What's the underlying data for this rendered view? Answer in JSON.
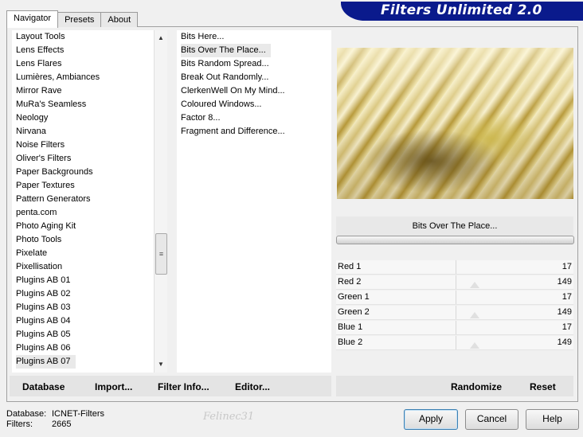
{
  "tabs": [
    {
      "label": "Navigator"
    },
    {
      "label": "Presets"
    },
    {
      "label": "About"
    }
  ],
  "header": {
    "title": "Filters Unlimited 2.0"
  },
  "categories": [
    "Layout Tools",
    "Lens Effects",
    "Lens Flares",
    "Lumières, Ambiances",
    "Mirror Rave",
    "MuRa's Seamless",
    "Neology",
    "Nirvana",
    "Noise Filters",
    "Oliver's Filters",
    "Paper Backgrounds",
    "Paper Textures",
    "Pattern Generators",
    "penta.com",
    "Photo Aging Kit",
    "Photo Tools",
    "Pixelate",
    "Pixellisation",
    "Plugins AB 01",
    "Plugins AB 02",
    "Plugins AB 03",
    "Plugins AB 04",
    "Plugins AB 05",
    "Plugins AB 06",
    "Plugins AB 07"
  ],
  "selected_category": "Plugins AB 07",
  "filters": [
    "Bits Here...",
    "Bits Over The Place...",
    "Bits Random Spread...",
    "Break Out Randomly...",
    "ClerkenWell On My Mind...",
    "Coloured Windows...",
    "Factor 8...",
    "Fragment and Difference..."
  ],
  "selected_filter": "Bits Over The Place...",
  "filter_title": "Bits Over The Place...",
  "params": [
    {
      "label": "Red 1",
      "value": "17"
    },
    {
      "label": "Red 2",
      "value": "149"
    },
    {
      "label": "Green 1",
      "value": "17"
    },
    {
      "label": "Green 2",
      "value": "149"
    },
    {
      "label": "Blue 1",
      "value": "17"
    },
    {
      "label": "Blue 2",
      "value": "149"
    }
  ],
  "toolbar": {
    "database": "Database",
    "import": "Import...",
    "filter_info": "Filter Info...",
    "editor": "Editor...",
    "randomize": "Randomize",
    "reset": "Reset"
  },
  "info": {
    "database_label": "Database:",
    "database_value": "ICNET-Filters",
    "filters_label": "Filters:",
    "filters_value": "2665"
  },
  "watermark": "Felinec31",
  "buttons": {
    "apply": "Apply",
    "cancel": "Cancel",
    "help": "Help"
  }
}
